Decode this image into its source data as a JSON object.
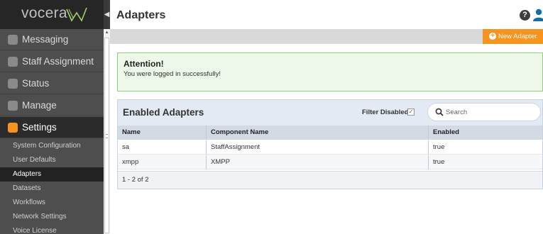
{
  "app": {
    "logo_text": "vocera"
  },
  "sidebar": {
    "items": [
      {
        "label": "Messaging",
        "icon": "chat-bubble-icon"
      },
      {
        "label": "Staff Assignment",
        "icon": "staff-assignment-icon"
      },
      {
        "label": "Status",
        "icon": "status-icon"
      },
      {
        "label": "Manage",
        "icon": "manage-icon"
      },
      {
        "label": "Settings",
        "icon": "wrench-icon"
      }
    ],
    "settings_subitems": [
      {
        "label": "System Configuration"
      },
      {
        "label": "User Defaults"
      },
      {
        "label": "Adapters"
      },
      {
        "label": "Datasets"
      },
      {
        "label": "Workflows"
      },
      {
        "label": "Network Settings"
      },
      {
        "label": "Voice License"
      }
    ],
    "active_subitem": "Adapters"
  },
  "header": {
    "title": "Adapters",
    "help_label": "?"
  },
  "toolbar": {
    "new_adapter_label": "New Adapter"
  },
  "alert": {
    "title": "Attention!",
    "message": "You were logged in successfully!"
  },
  "panel": {
    "title": "Enabled Adapters",
    "filter_label": "Filter Disabled:",
    "filter_checked": true,
    "search_placeholder": "Search",
    "columns": [
      "Name",
      "Component Name",
      "Enabled"
    ],
    "rows": [
      [
        "sa",
        "StaffAssignment",
        "true"
      ],
      [
        "xmpp",
        "XMPP",
        "true"
      ]
    ],
    "pager_text": "1 - 2 of 2"
  },
  "colors": {
    "accent": "#f7941d",
    "sidebar_bg": "#4e4e4e",
    "alert_border": "#8ed07b",
    "panel_head": "#e3eaf3"
  }
}
